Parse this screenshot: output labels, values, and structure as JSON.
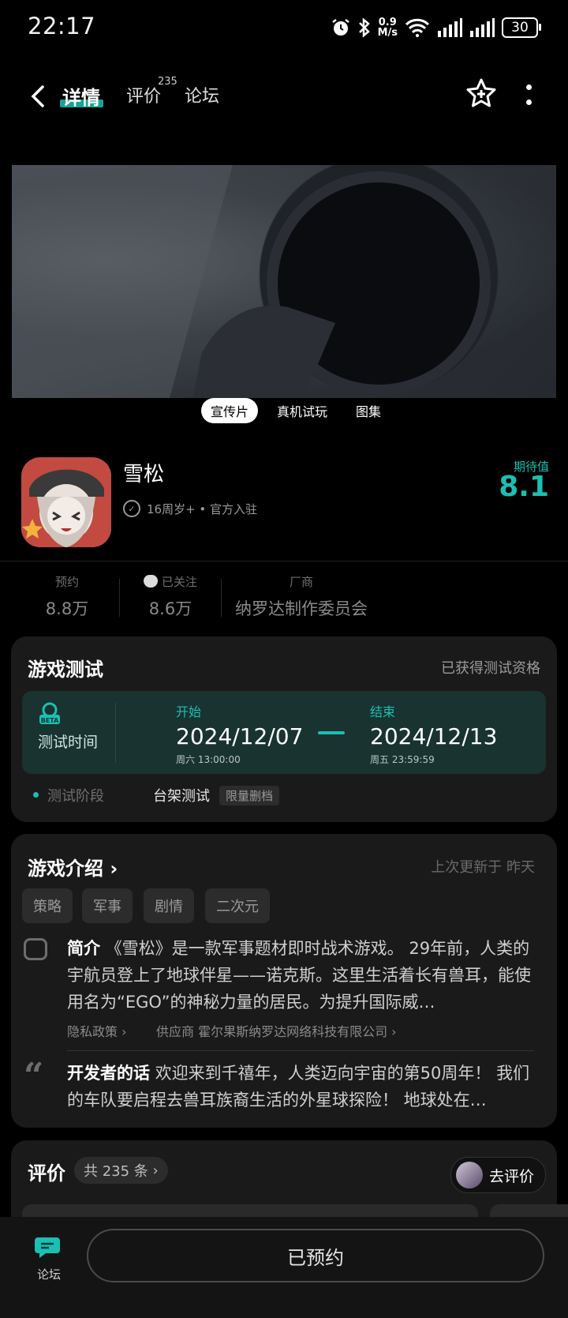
{
  "status_bar": {
    "time": "22:17",
    "net_speed_value": "0.9",
    "net_speed_unit": "M/s",
    "battery": "30"
  },
  "header": {
    "tabs": [
      {
        "label": "详情",
        "active": true
      },
      {
        "label": "评价",
        "badge": "235"
      },
      {
        "label": "论坛"
      }
    ]
  },
  "media": {
    "tabs": [
      "宣传片",
      "真机试玩",
      "图集"
    ],
    "active_tab": "宣传片"
  },
  "game": {
    "name": "雪松",
    "meta": "16周岁+ • 官方入驻",
    "expect_label": "期待值",
    "expect_value": "8.1"
  },
  "stats": [
    {
      "label": "预约",
      "value": "8.8万"
    },
    {
      "label": "已关注",
      "value": "8.6万"
    },
    {
      "label": "厂商",
      "value": "纳罗达制作委员会"
    }
  ],
  "test_card": {
    "title": "游戏测试",
    "status": "已获得测试资格",
    "time_label": "测试时间",
    "start_label": "开始",
    "start_date": "2024/12/07",
    "start_sub": "周六  13:00:00",
    "end_label": "结束",
    "end_date": "2024/12/13",
    "end_sub": "周五  23:59:59",
    "stage_label": "测试阶段",
    "stage_value": "台架测试",
    "stage_tag": "限量删档"
  },
  "intro_card": {
    "title": "游戏介绍",
    "updated": "上次更新于 昨天",
    "tags": [
      "策略",
      "军事",
      "剧情",
      "二次元"
    ],
    "summary_label": "简介",
    "summary": "《雪松》是一款军事题材即时战术游戏。 29年前，人类的宇航员登上了地球伴星——诺克斯。这里生活着长有兽耳，能使用名为“EGO”的神秘力量的居民。为提升国际威…",
    "privacy_link": "隐私政策",
    "supplier_link": "供应商 霍尔果斯纳罗达网络科技有限公司",
    "dev_label": "开发者的话",
    "dev_text": "欢迎来到千禧年，人类迈向宇宙的第50周年！ 我们的车队要启程去兽耳族裔生活的外星球探险！ 地球处在…"
  },
  "review_card": {
    "title": "评价",
    "count": "共 235 条",
    "go_review": "去评价"
  },
  "bottom_bar": {
    "forum_label": "论坛",
    "reserved_label": "已预约"
  },
  "colors": {
    "accent": "#1bbfb3",
    "test_box_bg": "#193330",
    "card_bg": "#1a1a1a"
  }
}
